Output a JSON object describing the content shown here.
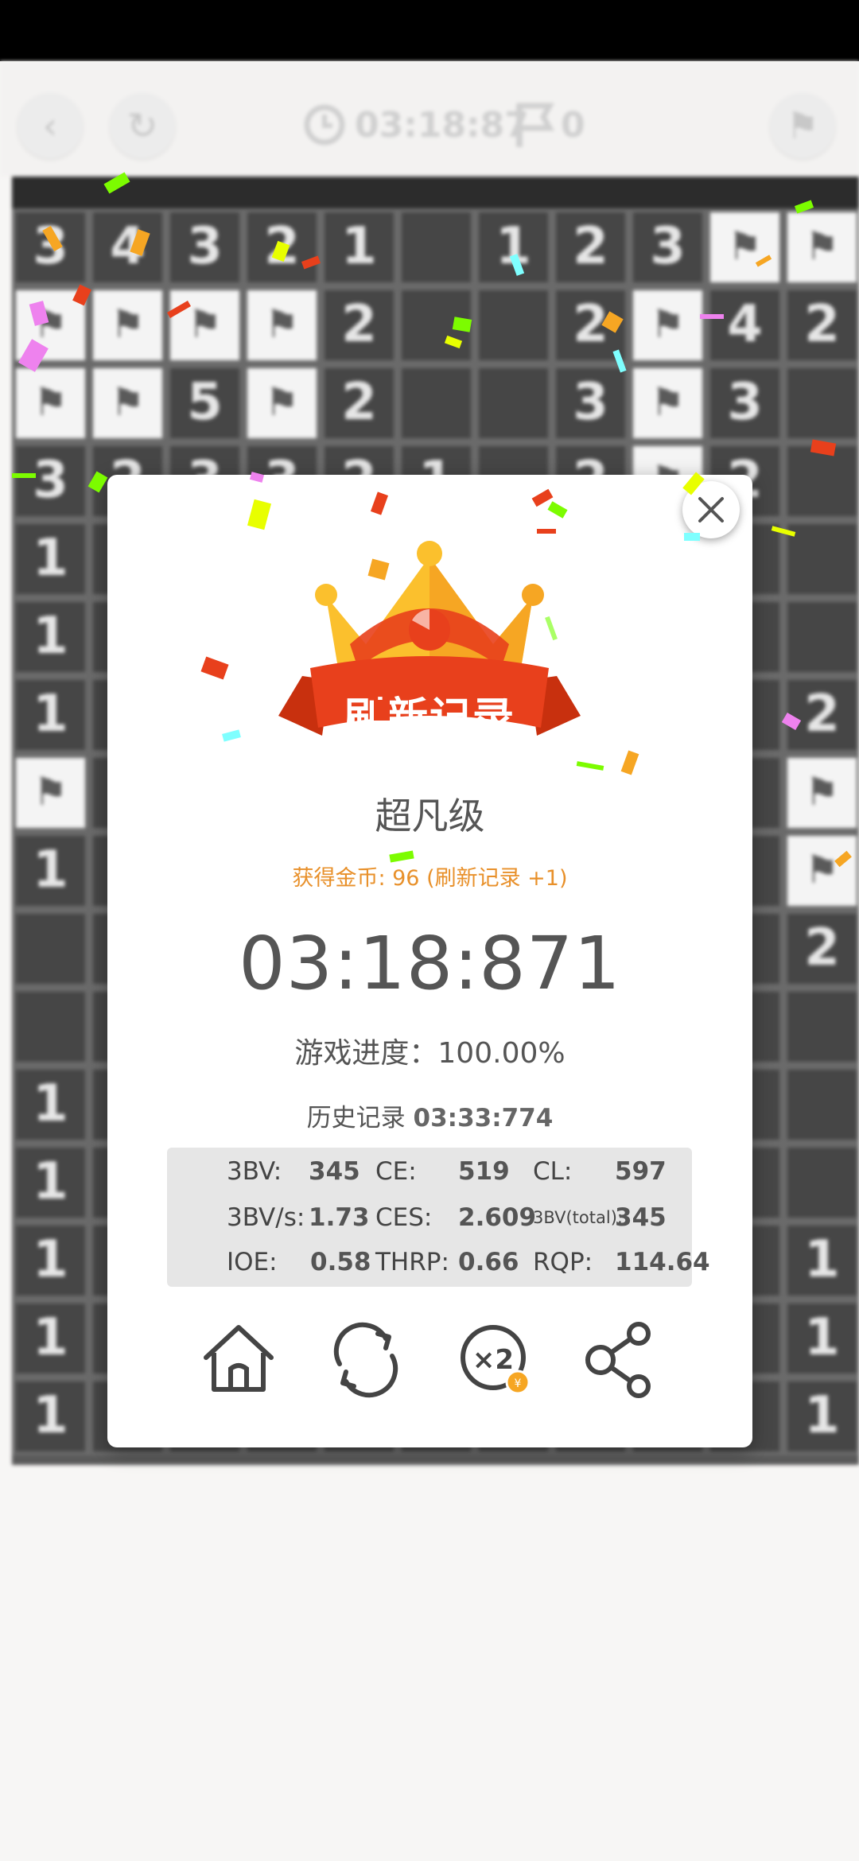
{
  "toolbar": {
    "timer": "03:18:87",
    "flags": "0",
    "back_glyph": "‹",
    "restart_glyph": "↻",
    "flag_glyph": "⚑"
  },
  "board": {
    "rows": [
      [
        "3",
        "4",
        "3",
        "2",
        "1",
        "",
        "1",
        "2",
        "3",
        "F",
        "F"
      ],
      [
        "F",
        "F",
        "F",
        "F",
        "2",
        "",
        "",
        "2",
        "F",
        "4",
        "2"
      ],
      [
        "F",
        "F",
        "5",
        "F",
        "2",
        "",
        "",
        "3",
        "F",
        "3",
        ""
      ],
      [
        "3",
        "2",
        "3",
        "3",
        "2",
        "1",
        "",
        "2",
        "F",
        "2",
        ""
      ],
      [
        "1",
        "",
        "",
        "",
        "",
        "",
        "",
        "",
        "",
        "",
        ""
      ],
      [
        "1",
        "",
        "",
        "",
        "",
        "",
        "",
        "",
        "",
        "",
        ""
      ],
      [
        "1",
        "",
        "",
        "",
        "",
        "",
        "",
        "",
        "",
        "",
        "2"
      ],
      [
        "F",
        "",
        "",
        "",
        "",
        "",
        "",
        "",
        "",
        "",
        "F"
      ],
      [
        "1",
        "",
        "",
        "",
        "",
        "",
        "",
        "",
        "",
        "",
        "F"
      ],
      [
        "",
        "",
        "",
        "",
        "",
        "",
        "",
        "",
        "",
        "",
        "2"
      ],
      [
        "",
        "",
        "",
        "",
        "",
        "",
        "",
        "",
        "",
        "",
        ""
      ],
      [
        "1",
        "",
        "",
        "",
        "",
        "",
        "",
        "",
        "",
        "",
        ""
      ],
      [
        "1",
        "",
        "",
        "",
        "",
        "",
        "",
        "",
        "",
        "",
        ""
      ],
      [
        "1",
        "",
        "",
        "",
        "",
        "",
        "",
        "",
        "",
        "",
        "1"
      ],
      [
        "1",
        "",
        "",
        "",
        "",
        "",
        "",
        "",
        "",
        "",
        "1"
      ],
      [
        "1",
        "",
        "",
        "",
        "",
        "",
        "",
        "",
        "",
        "",
        "1"
      ]
    ]
  },
  "result": {
    "badge": "刷新记录",
    "level": "超凡级",
    "coins": "获得金币: 96 (刷新记录 +1)",
    "time": "03:18:871",
    "progress": "游戏进度：100.00%",
    "history_label": "历史记录 ",
    "history_value": "03:33:774"
  },
  "stats": {
    "bv_label": "3BV:",
    "bv": "345",
    "ce_label": "CE:",
    "ce": "519",
    "cl_label": "CL:",
    "cl": "597",
    "bvs_label": "3BV/s:",
    "bvs": "1.73",
    "ces_label": "CES:",
    "ces": "2.609",
    "bvt_label": "3BV(total):",
    "bvt": "345",
    "ioe_label": "IOE:",
    "ioe": "0.58",
    "thrp_label": "THRP:",
    "thrp": "0.66",
    "rqp_label": "RQP:",
    "rqp": "114.64"
  },
  "colors": {
    "accent_orange": "#e8902a",
    "ribbon_red": "#e8401c",
    "crown_yellow": "#fbc02d"
  },
  "icons": [
    "home-icon",
    "refresh-icon",
    "double-coins-icon",
    "share-icon",
    "close-icon"
  ]
}
